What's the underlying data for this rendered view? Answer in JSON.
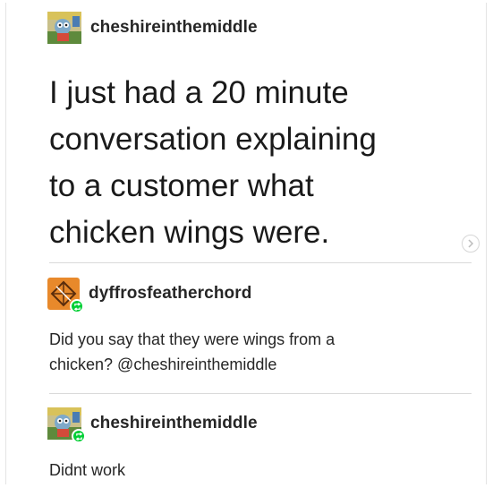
{
  "posts": [
    {
      "username": "cheshireinthemiddle",
      "avatar_icon": "cartoon-avatar-icon",
      "text": "I just had a 20 minute\nconversation explaining\nto a customer what\nchicken wings were."
    },
    {
      "username": "dyffrosfeatherchord",
      "avatar_icon": "geometric-avatar-icon",
      "badge_icon": "reblog-icon",
      "text": "Did you say that they were wings from a\nchicken? @cheshireinthemiddle"
    },
    {
      "username": "cheshireinthemiddle",
      "avatar_icon": "cartoon-avatar-icon",
      "badge_icon": "reblog-icon",
      "text": "Didnt work"
    }
  ],
  "nav": {
    "icon": "chevron-right-icon"
  },
  "colors": {
    "reblog_green": "#00cf35",
    "avatar_orange": "#e8892b",
    "divider": "#dadada"
  }
}
